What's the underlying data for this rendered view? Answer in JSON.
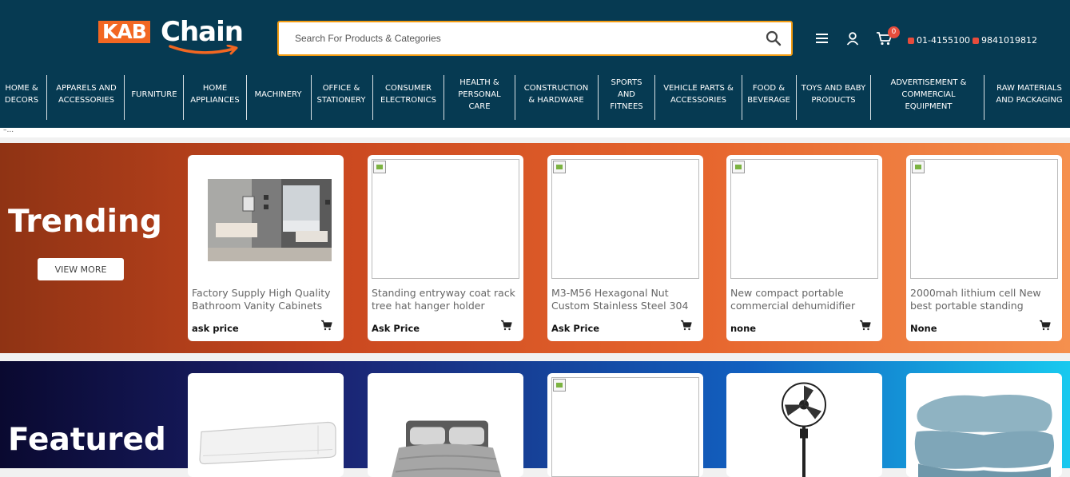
{
  "brand": {
    "logo_part1": "KAB",
    "logo_part2": "Chain",
    "accent": "#f26722",
    "header_bg": "#063a52"
  },
  "search": {
    "placeholder": "Search For Products & Categories"
  },
  "header": {
    "cart_count": "0",
    "phone1": "01-4155100",
    "phone2": "9841019812"
  },
  "nav": [
    "HOME & DECORS",
    "APPARELS AND ACCESSORIES",
    "FURNITURE",
    "HOME APPLIANCES",
    "MACHINERY",
    "OFFICE & STATIONERY",
    "CONSUMER ELECTRONICS",
    "HEALTH & PERSONAL CARE",
    "CONSTRUCTION & HARDWARE",
    "SPORTS AND FITNEES",
    "VEHICLE PARTS & ACCESSORIES",
    "FOOD & BEVERAGE",
    "TOYS AND BABY PRODUCTS",
    "ADVERTISEMENT & COMMERCIAL EQUIPMENT",
    "RAW MATERIALS AND PACKAGING"
  ],
  "strip_text": "–...",
  "trending": {
    "title": "Trending",
    "view_more": "VIEW MORE",
    "products": [
      {
        "title": "Factory Supply High Quality Bathroom Vanity Cabinets",
        "price": "ask price"
      },
      {
        "title": "Standing entryway coat rack tree hat hanger holder",
        "price": "Ask Price"
      },
      {
        "title": "M3-M56 Hexagonal Nut Custom Stainless Steel 304",
        "price": "Ask Price"
      },
      {
        "title": "New compact portable commercial dehumidifier",
        "price": "none"
      },
      {
        "title": "2000mah lithium cell New best portable standing",
        "price": "None"
      }
    ]
  },
  "featured": {
    "title": "Featured"
  }
}
